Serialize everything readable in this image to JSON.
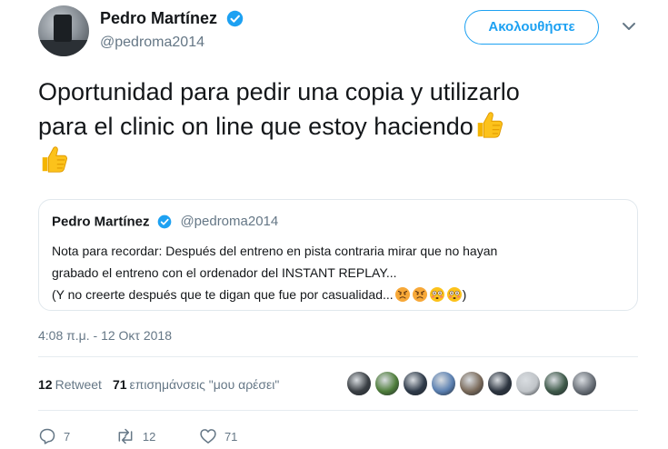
{
  "author": {
    "display_name": "Pedro Martínez",
    "handle": "@pedroma2014",
    "verified": true
  },
  "follow_button": {
    "label": "Ακολουθήστε"
  },
  "tweet": {
    "text_line1": "Oportunidad para pedir una copia y utilizarlo",
    "text_line2": "para el clinic on line que estoy haciendo",
    "emojis": [
      "thumbs-up",
      "thumbs-up"
    ]
  },
  "quoted_tweet": {
    "display_name": "Pedro Martínez",
    "handle": "@pedroma2014",
    "verified": true,
    "line1": "Nota para recordar: Después del entreno en pista contraria mirar que no hayan",
    "line2": "grabado el entreno con el ordenador del INSTANT REPLAY...",
    "line3": "(Y no creerte después que te digan que fue por casualidad...",
    "line3_end": ")",
    "emojis": [
      "angry-face",
      "angry-face",
      "flushed-face",
      "flushed-face"
    ]
  },
  "timestamp": "4:08 π.μ. - 12 Οκτ 2018",
  "stats": {
    "retweets_count": "12",
    "retweets_label": "Retweet",
    "likes_count": "71",
    "likes_label": "επισημάνσεις \"μου αρέσει\""
  },
  "liker_avatars": [
    "#3a3f44",
    "#4e7d3a",
    "#2f3b4a",
    "#5a7fb0",
    "#7a6a5a",
    "#2d3540",
    "#c0c4c8",
    "#3f5a4a",
    "#6a7078"
  ],
  "actions": {
    "reply_count": "7",
    "retweet_count": "12",
    "like_count": "71"
  },
  "colors": {
    "accent": "#1da1f2",
    "secondary_text": "#657786",
    "border": "#e1e8ed"
  }
}
